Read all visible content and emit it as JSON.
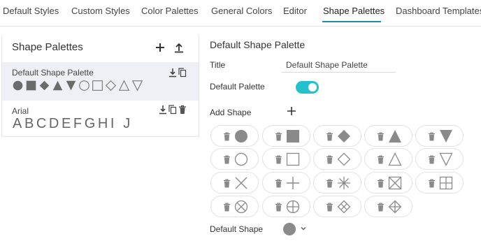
{
  "tabs": [
    {
      "label": "Default Styles"
    },
    {
      "label": "Custom Styles"
    },
    {
      "label": "Color Palettes"
    },
    {
      "label": "General Colors"
    },
    {
      "label": "Editor"
    },
    {
      "label": "Shape Palettes",
      "active": true
    },
    {
      "label": "Dashboard Templates"
    }
  ],
  "left_panel": {
    "title": "Shape Palettes",
    "palettes": [
      {
        "name": "Default Shape Palette",
        "selected": true
      },
      {
        "name": "Arial",
        "selected": false,
        "preview_text": "ABCDEFGHI J"
      }
    ]
  },
  "editor": {
    "title": "Default Shape Palette",
    "title_label": "Title",
    "title_value": "Default Shape Palette",
    "default_palette_label": "Default Palette",
    "default_palette_on": true,
    "add_shape_label": "Add Shape",
    "shapes": [
      "filled-circle",
      "filled-square",
      "filled-diamond",
      "filled-triangle-up",
      "filled-triangle-down",
      "circle",
      "square",
      "diamond",
      "triangle-up",
      "triangle-down",
      "cross-x",
      "plus",
      "asterisk",
      "boxed-x",
      "boxed-plus",
      "circled-x",
      "circled-plus",
      "boxed-diamond-x",
      "diamond-plus"
    ],
    "default_shape_label": "Default Shape",
    "default_shape": "filled-circle"
  },
  "colors": {
    "accent": "#1c8fa0",
    "toggle": "#22c1cc",
    "shape": "#8a8a8a",
    "selected_row": "#eef0f5"
  }
}
